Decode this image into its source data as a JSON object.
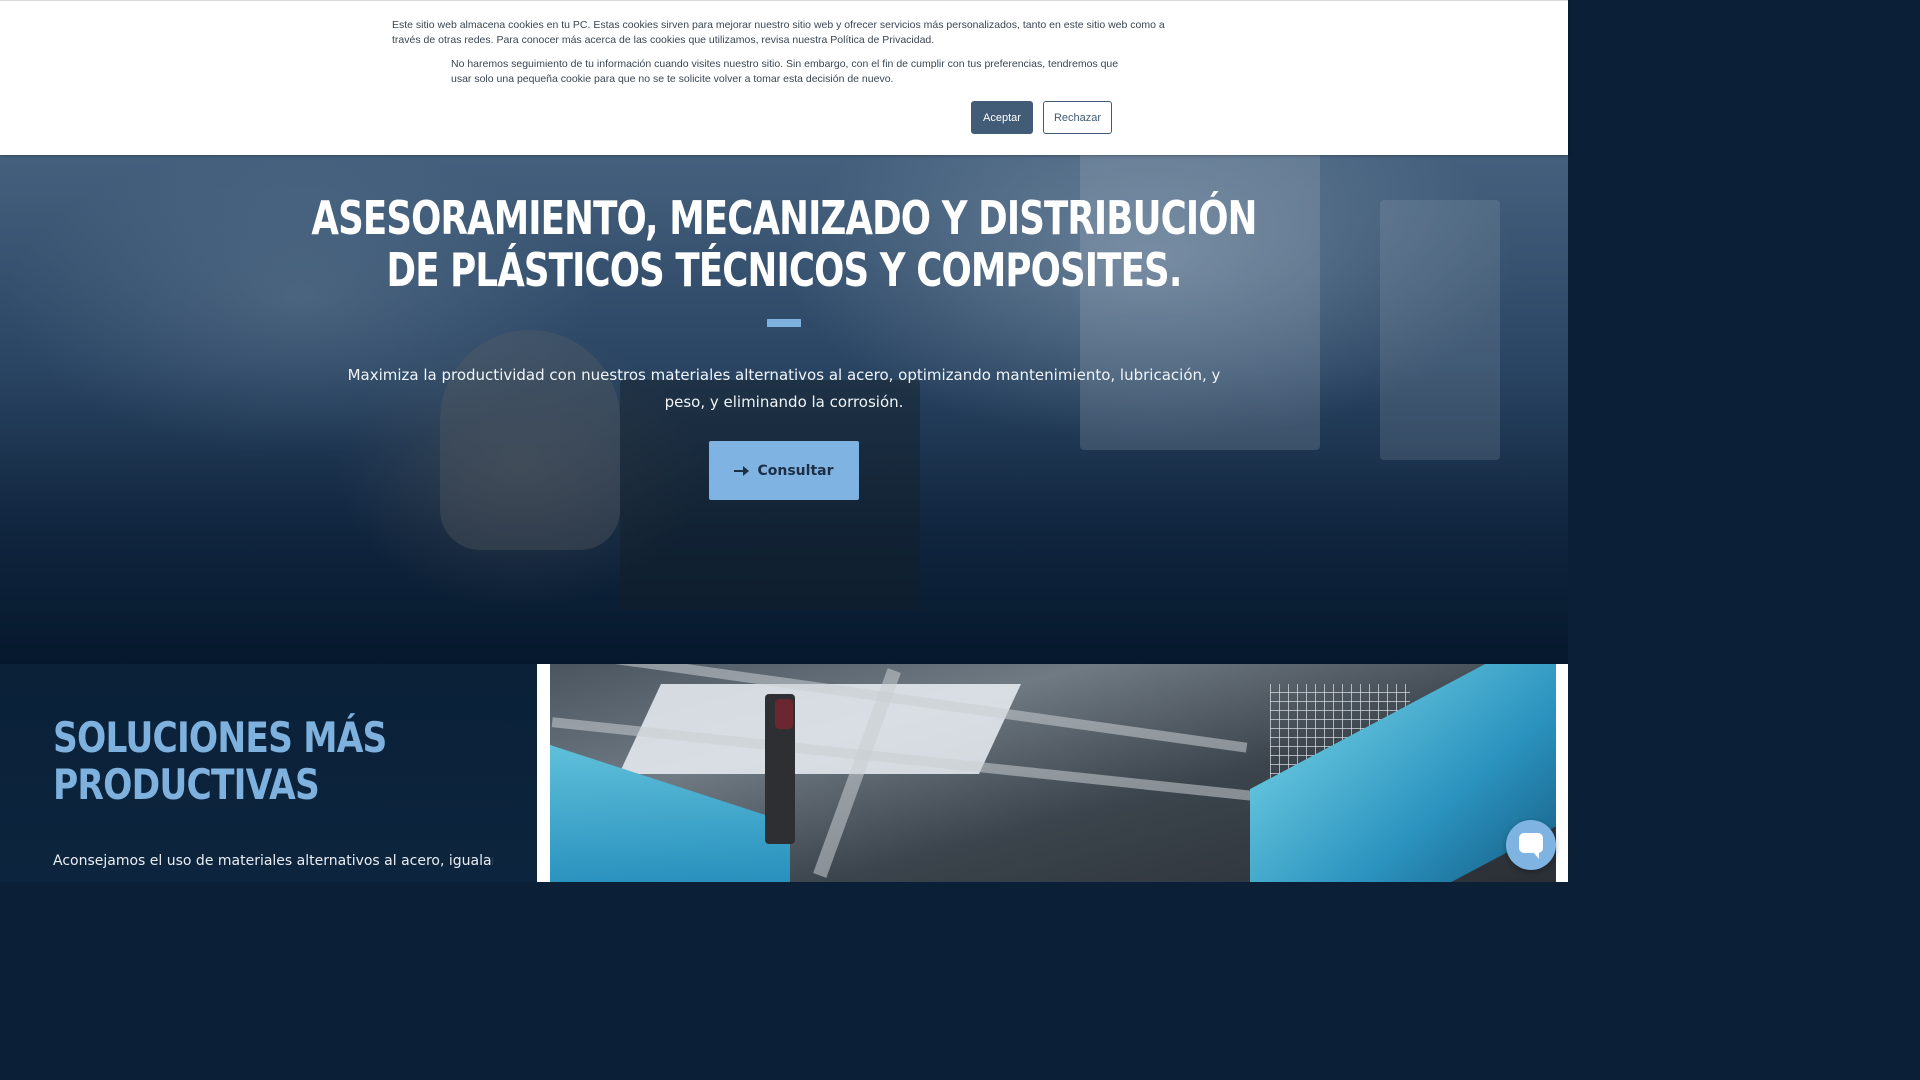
{
  "cookie_banner": {
    "paragraph_1": "Este sitio web almacena cookies en tu PC. Estas cookies sirven para mejorar nuestro sitio web y ofrecer servicios más personalizados, tanto en este sitio web como a través de otras redes. Para conocer más acerca de las cookies que utilizamos, revisa nuestra Política de Privacidad.",
    "paragraph_2": "No haremos seguimiento de tu información cuando visites nuestro sitio. Sin embargo, con el fin de cumplir con tus preferencias, tendremos que usar solo una pequeña cookie para que no se te solicite volver a tomar esta decisión de nuevo.",
    "accept_label": "Aceptar",
    "reject_label": "Rechazar"
  },
  "hero": {
    "title_line_1": "ASESORAMIENTO, MECANIZADO Y DISTRIBUCIÓN",
    "title_line_2": "DE PLÁSTICOS TÉCNICOS Y COMPOSITES.",
    "subtitle": "Maximiza la productividad con nuestros materiales alternativos al acero, optimizando mantenimiento, lubricación, y peso, y eliminando la corrosión.",
    "cta_label": "Consultar",
    "cta_icon": "arrow-right-icon"
  },
  "section_solutions": {
    "title_line_1": "SOLUCIONES MÁS",
    "title_line_2": "PRODUCTIVAS",
    "body": "Aconsejamos el uso de materiales alternativos al acero, igualando"
  },
  "chat_widget": {
    "icon": "chat-bubble-icon"
  },
  "colors": {
    "accent": "#7fb3e2",
    "cookie_button": "#425b76",
    "hero_dark": "#05182c"
  }
}
